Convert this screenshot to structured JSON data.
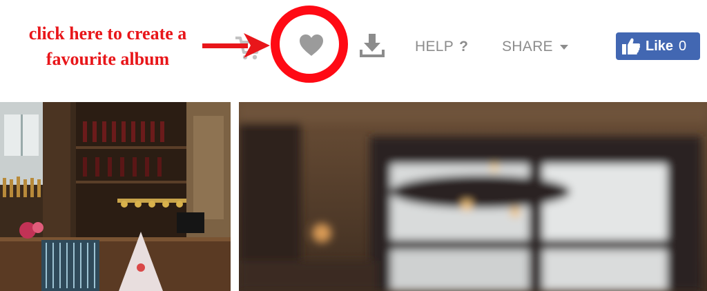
{
  "annotation": {
    "line1": "click here to create a",
    "line2": "favourite album",
    "color": "#e8161a"
  },
  "toolbar": {
    "icons": [
      "cart-icon",
      "heart-icon",
      "download-icon"
    ],
    "help_label": "HELP",
    "help_symbol": "?",
    "share_label": "SHARE"
  },
  "facebook": {
    "label": "Like",
    "count": "0",
    "color": "#4267b2"
  },
  "colors": {
    "highlight_ring": "#ff0a14",
    "nav_text": "#8c8c8c"
  }
}
